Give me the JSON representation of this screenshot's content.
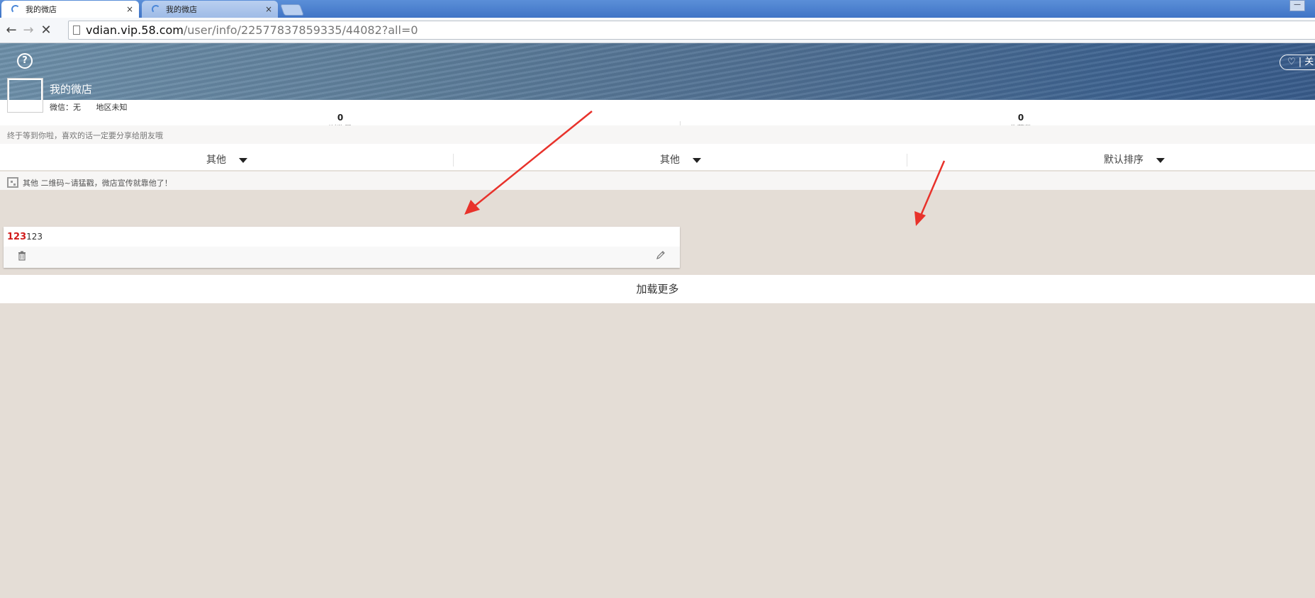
{
  "browser": {
    "tabs": [
      {
        "title": "我的微店",
        "active": true
      },
      {
        "title": "我的微店",
        "active": false
      }
    ],
    "tab_close_glyph": "×",
    "url_host": "vdian.vip.58.com",
    "url_path": "/user/info/22577837859335/44082?all=0",
    "window_btn": "—"
  },
  "header": {
    "help_glyph": "?",
    "favorite_label": "♡ | 关",
    "shop_name": "我的微店",
    "wechat": "微信：无",
    "region": "地区未知"
  },
  "stats": [
    {
      "value": "0",
      "label": "浏览量"
    },
    {
      "value": "0",
      "label": "收藏数"
    }
  ],
  "notice": "终于等到你啦，喜欢的话一定要分享给朋友哦",
  "filters": [
    "其他",
    "其他",
    "默认排序"
  ],
  "qr_text": "其他 二维码~请猛戳，微店宣传就靠他了！",
  "items": [
    {
      "title_highlight": "123",
      "title_rest": "123"
    }
  ],
  "load_more": "加载更多",
  "colors": {
    "price_red": "#d11b1b",
    "page_bg": "#e4ddd6",
    "annotation_arrow": "#e8322b"
  }
}
